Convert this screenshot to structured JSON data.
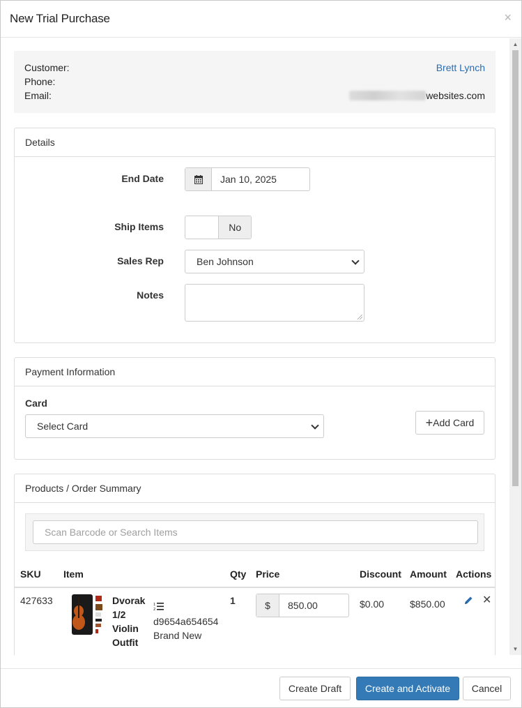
{
  "modal": {
    "title": "New Trial Purchase",
    "close_glyph": "×"
  },
  "customer": {
    "customer_label": "Customer:",
    "phone_label": "Phone:",
    "email_label": "Email:",
    "customer_name": "Brett Lynch",
    "phone": "",
    "email_visible_suffix": "websites.com"
  },
  "details": {
    "heading": "Details",
    "end_date_label": "End Date",
    "end_date_value": "Jan 10, 2025",
    "ship_items_label": "Ship Items",
    "ship_items_value": "No",
    "sales_rep_label": "Sales Rep",
    "sales_rep_value": "Ben Johnson",
    "notes_label": "Notes",
    "notes_value": ""
  },
  "payment": {
    "heading": "Payment Information",
    "card_label": "Card",
    "card_select_value": "Select Card",
    "add_card_label": "Add Card"
  },
  "products": {
    "heading": "Products / Order Summary",
    "search_placeholder": "Scan Barcode or Search Items",
    "columns": {
      "sku": "SKU",
      "item": "Item",
      "qty": "Qty",
      "price": "Price",
      "discount": "Discount",
      "amount": "Amount",
      "actions": "Actions"
    },
    "rows": [
      {
        "sku": "427633",
        "item_name_lines": [
          "Dvorak",
          "1/2",
          "Violin",
          "Outfit"
        ],
        "serial": "d9654a654654",
        "condition": "Brand New",
        "qty": "1",
        "currency_symbol": "$",
        "price": "850.00",
        "discount": "$0.00",
        "amount": "$850.00"
      }
    ]
  },
  "footer": {
    "create_draft": "Create Draft",
    "create_and_activate": "Create and Activate",
    "cancel": "Cancel"
  },
  "colors": {
    "link": "#2a6db3",
    "primary": "#337ab7",
    "panel_border": "#dddddd",
    "well_bg": "#f5f5f5"
  },
  "icons": {
    "calendar": "calendar-icon",
    "plus": "plus-icon",
    "list_ordered": "ordered-list-icon",
    "pencil": "pencil-icon",
    "remove": "remove-icon",
    "chevron": "chevron-down-icon"
  }
}
